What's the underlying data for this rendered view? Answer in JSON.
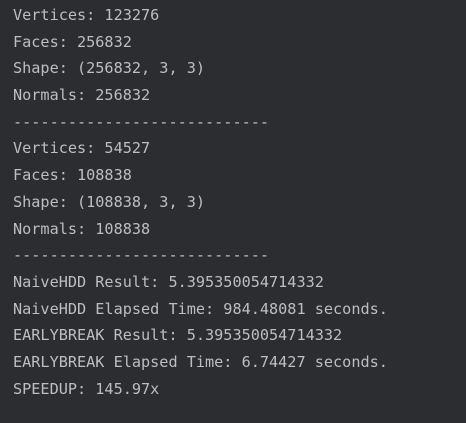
{
  "console": {
    "lines": [
      "Vertices: 123276",
      "Faces: 256832",
      "Shape: (256832, 3, 3)",
      "Normals: 256832",
      "----------------------------",
      "Vertices: 54527",
      "Faces: 108838",
      "Shape: (108838, 3, 3)",
      "Normals: 108838",
      "----------------------------",
      "NaiveHDD Result: 5.395350054714332",
      "NaiveHDD Elapsed Time: 984.48081 seconds.",
      "EARLYBREAK Result: 5.395350054714332",
      "EARLYBREAK Elapsed Time: 6.74427 seconds.",
      "SPEEDUP: 145.97x"
    ]
  },
  "colors": {
    "background": "#2b2d30",
    "text": "#bcbec4"
  }
}
